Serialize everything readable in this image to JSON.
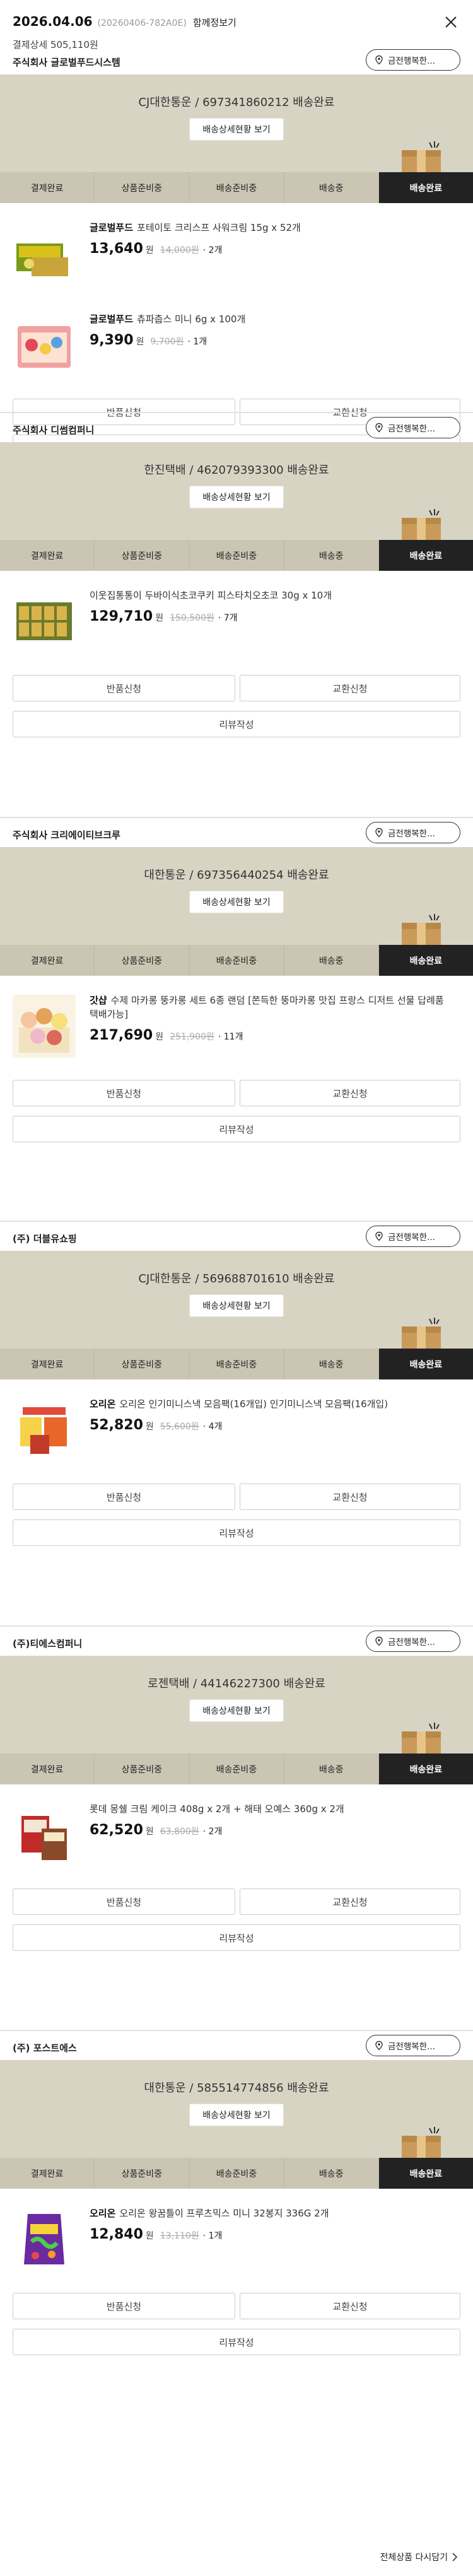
{
  "header": {
    "date": "2026.04.06",
    "order_code": "(20260406-782A0E)",
    "detail_link": "함께정보기",
    "total": "결제상세 505,110원",
    "close_icon": "close-icon"
  },
  "common": {
    "contact_label": "금전행복한...",
    "track_label": "배송상세현황 보기",
    "return_label": "반품신청",
    "exchange_label": "교환신청",
    "review_label": "리뷰작성",
    "won": "원"
  },
  "steps": [
    "결제완료",
    "상품준비중",
    "배송준비중",
    "배송중",
    "배송완료"
  ],
  "active_step": 4,
  "colors": {
    "status_bg": "#d8d4c4",
    "active_step_bg": "#222222",
    "steps_bg": "#cbc6b4"
  },
  "sections": [
    {
      "seller": "주식회사 글로벌푸드시스템",
      "courier": "CJ대한통운 / 697341860212 배송완료",
      "items": [
        {
          "brand": "글로벌푸드",
          "name": "포테이토 크리스프 사워크림 15g x 52개",
          "price": "13,640",
          "orig": "14,000원",
          "qty": "· 2개"
        },
        {
          "brand": "글로벌푸드",
          "name": "츄파춥스 미니 6g x 100개",
          "price": "9,390",
          "orig": "9,700원",
          "qty": "· 1개"
        }
      ]
    },
    {
      "seller": "주식회사 디썸컴퍼니",
      "courier": "한진택배 / 462079393300 배송완료",
      "items": [
        {
          "brand": "",
          "name": "이웃집통통이 두바이식초코쿠키 피스타치오초코 30g x 10개",
          "price": "129,710",
          "orig": "150,500원",
          "qty": "· 7개"
        }
      ]
    },
    {
      "seller": "주식회사 크리에이티브크루",
      "courier": "대한통운 / 697356440254 배송완료",
      "items": [
        {
          "brand": "갓샵",
          "name": "수제 마카롱 뚱카롱 세트 6종 랜덤 [쫀득한 뚱마카롱 맛집 프랑스 디저트 선물 답례품 택배가능]",
          "price": "217,690",
          "orig": "251,900원",
          "qty": "· 11개"
        }
      ]
    },
    {
      "seller": "(주) 더블유쇼핑",
      "courier": "CJ대한통운 / 569688701610 배송완료",
      "items": [
        {
          "brand": "오리온",
          "name": "오리온 인기미니스낵 모음팩(16개입) 인기미니스낵 모음팩(16개입)",
          "price": "52,820",
          "orig": "55,600원",
          "qty": "· 4개"
        }
      ]
    },
    {
      "seller": "(주)티에스컴퍼니",
      "courier": "로젠택배 / 44146227300 배송완료",
      "items": [
        {
          "brand": "",
          "name": "롯데 몽쉘 크림 케이크 408g x 2개 + 해태 오예스 360g x 2개",
          "price": "62,520",
          "orig": "63,800원",
          "qty": "· 2개"
        }
      ]
    },
    {
      "seller": "(주) 포스트에스",
      "courier": "대한통운 / 585514774856 배송완료",
      "items": [
        {
          "brand": "오리온",
          "name": "오리온 왕꿈틀이 프루츠믹스 미니 32봉지 336G 2개",
          "price": "12,840",
          "orig": "13,110원",
          "qty": "· 1개"
        }
      ]
    }
  ],
  "footer": {
    "label": "전체상품 다시담기"
  }
}
